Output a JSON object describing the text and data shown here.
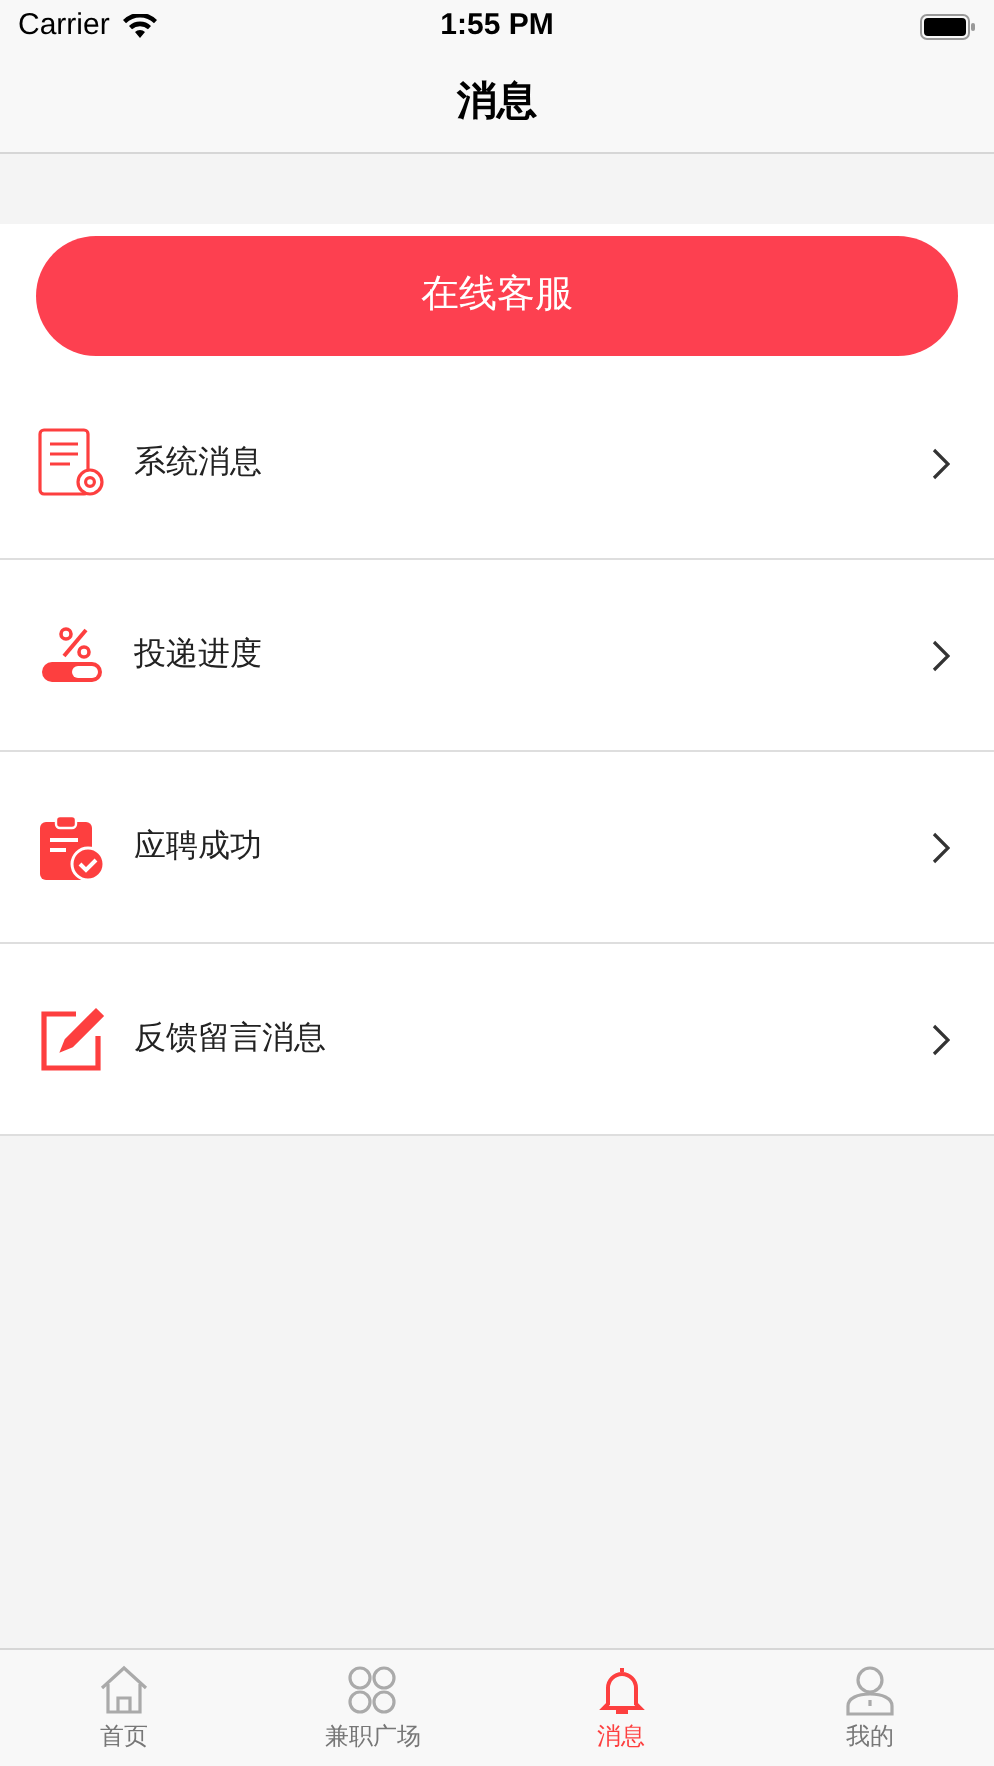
{
  "status_bar": {
    "carrier": "Carrier",
    "time": "1:55 PM"
  },
  "nav": {
    "title": "消息"
  },
  "service_button": {
    "label": "在线客服"
  },
  "items": [
    {
      "kind": "system",
      "label": "系统消息"
    },
    {
      "kind": "progress",
      "label": "投递进度"
    },
    {
      "kind": "success",
      "label": "应聘成功"
    },
    {
      "kind": "feedback",
      "label": "反馈留言消息"
    }
  ],
  "tabs": [
    {
      "kind": "home",
      "label": "首页",
      "selected": false
    },
    {
      "kind": "square",
      "label": "兼职广场",
      "selected": false
    },
    {
      "kind": "messages",
      "label": "消息",
      "selected": true
    },
    {
      "kind": "mine",
      "label": "我的",
      "selected": false
    }
  ]
}
